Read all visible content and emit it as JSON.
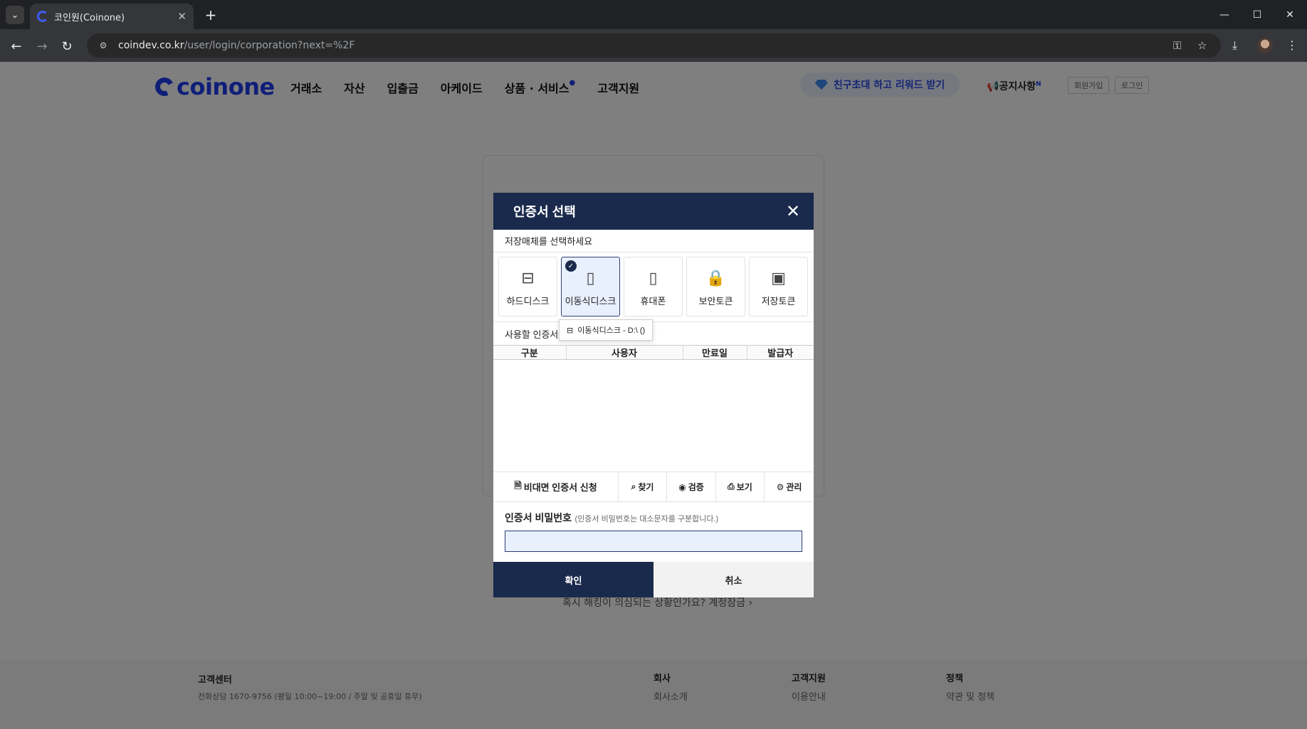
{
  "browser": {
    "tab_title": "코인원(Coinone)",
    "url_host": "coindev.co.kr",
    "url_path": "/user/login/corporation?next=%2F"
  },
  "site": {
    "logo": "coinone",
    "nav": [
      "거래소",
      "자산",
      "입출금",
      "아케이드",
      "상품 · 서비스",
      "고객지원"
    ],
    "invite_banner": "친구초대 하고 리워드 받기",
    "notice": "공지사항",
    "notice_badge": "N",
    "signup": "회원가입",
    "login": "로그인",
    "hack_link": "혹시 해킹이 의심되는 상황인가요? 계정잠금 ›"
  },
  "footer": {
    "support_title": "고객센터",
    "phone": "전화상담  1670-9756 (평일 10:00~19:00 / 주말 및 공휴일 휴무)",
    "company_title": "회사",
    "company_link": "회사소개",
    "support2_title": "고객지원",
    "support2_link": "이용안내",
    "policy_title": "정책",
    "policy_link": "약관 및 정책"
  },
  "dialog": {
    "title": "인증서 선택",
    "media_prompt": "저장매체를 선택하세요",
    "media": [
      {
        "label": "하드디스크",
        "icon": "hard-disk-icon"
      },
      {
        "label": "이동식디스크",
        "icon": "usb-icon",
        "selected": true
      },
      {
        "label": "휴대폰",
        "icon": "phone-icon"
      },
      {
        "label": "보안토큰",
        "icon": "security-token-icon"
      },
      {
        "label": "저장토큰",
        "icon": "storage-token-icon"
      }
    ],
    "cert_prompt": "사용할 인증서",
    "drive_option": "이동식디스크 - D:\\ ()",
    "columns": [
      "구분",
      "사용자",
      "만료일",
      "발급자"
    ],
    "actions": [
      "비대면 인증서 신청",
      "찾기",
      "검증",
      "보기",
      "관리"
    ],
    "password_label": "인증서 비밀번호",
    "password_hint": "(인증서 비밀번호는 대소문자를 구분합니다.)",
    "password_value": "",
    "ok": "확인",
    "cancel": "취소"
  }
}
